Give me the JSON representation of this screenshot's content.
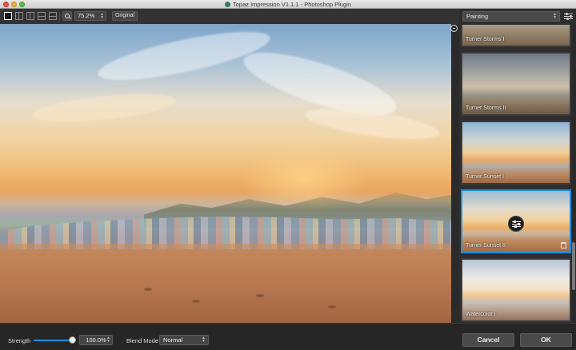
{
  "window": {
    "title": "Topaz Impression V1.1.1 - Photoshop Plugin"
  },
  "toolbar": {
    "view_modes": [
      "single-view",
      "split-vertical",
      "side-by-side",
      "split-horizontal",
      "stacked"
    ],
    "zoom_value": "75.2%",
    "original_label": "Original"
  },
  "panel": {
    "category": "Painting",
    "presets": [
      {
        "label": "Turner Storms I",
        "selected": false
      },
      {
        "label": "Turner Storms II",
        "selected": false
      },
      {
        "label": "Turner Sunset I",
        "selected": false
      },
      {
        "label": "Turner Sunset II",
        "selected": true
      },
      {
        "label": "Watercolor I",
        "selected": false
      }
    ]
  },
  "bottom": {
    "strength_label": "Strength",
    "strength_value": "100.0%",
    "strength_fraction": 1.0,
    "blend_label": "Blend Mode",
    "blend_value": "Normal",
    "cancel_label": "Cancel",
    "ok_label": "OK"
  },
  "colors": {
    "accent": "#1c8fe0",
    "background": "#2b2b2b"
  }
}
